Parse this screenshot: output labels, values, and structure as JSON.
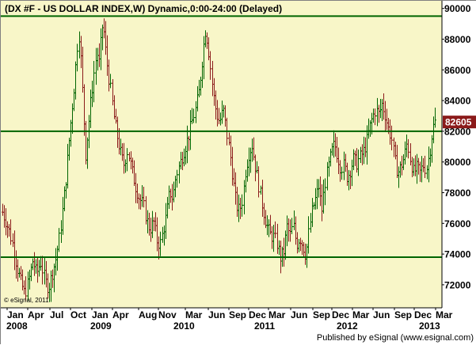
{
  "chart_data": {
    "type": "bar",
    "subtype": "ohlc-weekly",
    "title": "(DX #F - US DOLLAR INDEX,W) Dynamic,0:00-24:00 (Delayed)",
    "ylim": [
      70500,
      90500
    ],
    "yticks": [
      72000,
      74000,
      76000,
      78000,
      80000,
      82000,
      84000,
      86000,
      88000,
      90000
    ],
    "ytick_labels": [
      "72000",
      "74000",
      "76000",
      "78000",
      "80000",
      "82000",
      "84000",
      "86000",
      "88000",
      "90000"
    ],
    "month_labels": [
      "Jan",
      "Apr",
      "Jul",
      "Oct",
      "Jan",
      "Apr",
      "Aug",
      "Nov",
      "Mar",
      "Jun",
      "Sep",
      "Dec",
      "Mar",
      "Jun",
      "Sep",
      "Dec",
      "Mar",
      "Jun",
      "Sep",
      "Dec",
      "Mar"
    ],
    "year_labels": [
      "2008",
      "2009",
      "2010",
      "2011",
      "2012",
      "2013"
    ],
    "last_price_label": "82605",
    "last_price": 82605,
    "horizontal_lines": [
      89500,
      82000,
      73800
    ],
    "series": [
      {
        "close_path": [
          [
            0,
            77000
          ],
          [
            6,
            76200
          ],
          [
            11,
            75400
          ],
          [
            16,
            74400
          ],
          [
            20,
            73200
          ],
          [
            25,
            72200
          ],
          [
            30,
            71400
          ],
          [
            35,
            72300
          ],
          [
            40,
            73600
          ],
          [
            45,
            72700
          ],
          [
            50,
            73500
          ],
          [
            56,
            72200
          ],
          [
            60,
            71800
          ],
          [
            64,
            72600
          ],
          [
            69,
            73600
          ],
          [
            74,
            75200
          ],
          [
            78,
            77000
          ],
          [
            82,
            79000
          ],
          [
            86,
            81400
          ],
          [
            90,
            83600
          ],
          [
            93,
            85200
          ],
          [
            96,
            87400
          ],
          [
            99,
            88400
          ],
          [
            101,
            86400
          ],
          [
            104,
            83500
          ],
          [
            107,
            80500
          ],
          [
            111,
            82600
          ],
          [
            114,
            84200
          ],
          [
            117,
            85600
          ],
          [
            121,
            87200
          ],
          [
            124,
            86400
          ],
          [
            127,
            88400
          ],
          [
            129,
            89200
          ],
          [
            131,
            87800
          ],
          [
            135,
            86000
          ],
          [
            139,
            84500
          ],
          [
            143,
            82800
          ],
          [
            147,
            81600
          ],
          [
            151,
            80600
          ],
          [
            155,
            79800
          ],
          [
            160,
            80800
          ],
          [
            165,
            79500
          ],
          [
            170,
            78400
          ],
          [
            175,
            77600
          ],
          [
            180,
            77200
          ],
          [
            184,
            76200
          ],
          [
            188,
            75600
          ],
          [
            193,
            76100
          ],
          [
            197,
            74900
          ],
          [
            201,
            74600
          ],
          [
            205,
            75600
          ],
          [
            209,
            76600
          ],
          [
            213,
            78100
          ],
          [
            217,
            77600
          ],
          [
            221,
            79100
          ],
          [
            226,
            79900
          ],
          [
            230,
            80600
          ],
          [
            234,
            81200
          ],
          [
            238,
            81900
          ],
          [
            242,
            82800
          ],
          [
            246,
            83500
          ],
          [
            250,
            84600
          ],
          [
            254,
            86600
          ],
          [
            258,
            88600
          ],
          [
            261,
            87900
          ],
          [
            264,
            86400
          ],
          [
            268,
            84400
          ],
          [
            272,
            83100
          ],
          [
            276,
            82600
          ],
          [
            281,
            83400
          ],
          [
            285,
            81900
          ],
          [
            289,
            80600
          ],
          [
            293,
            78800
          ],
          [
            297,
            77200
          ],
          [
            301,
            76800
          ],
          [
            305,
            77600
          ],
          [
            309,
            79600
          ],
          [
            313,
            80600
          ],
          [
            317,
            81100
          ],
          [
            321,
            79800
          ],
          [
            325,
            78600
          ],
          [
            329,
            77400
          ],
          [
            333,
            76400
          ],
          [
            337,
            75600
          ],
          [
            341,
            75200
          ],
          [
            345,
            75100
          ],
          [
            349,
            74600
          ],
          [
            353,
            73700
          ],
          [
            357,
            74200
          ],
          [
            361,
            75800
          ],
          [
            365,
            75200
          ],
          [
            369,
            75900
          ],
          [
            373,
            74600
          ],
          [
            377,
            75100
          ],
          [
            381,
            74600
          ],
          [
            385,
            73900
          ],
          [
            389,
            75600
          ],
          [
            393,
            76900
          ],
          [
            397,
            77600
          ],
          [
            401,
            78400
          ],
          [
            405,
            76800
          ],
          [
            409,
            78600
          ],
          [
            413,
            79600
          ],
          [
            417,
            80600
          ],
          [
            421,
            81200
          ],
          [
            425,
            80400
          ],
          [
            429,
            79600
          ],
          [
            433,
            79800
          ],
          [
            437,
            79000
          ],
          [
            441,
            79500
          ],
          [
            445,
            80200
          ],
          [
            449,
            79900
          ],
          [
            453,
            80300
          ],
          [
            457,
            80600
          ],
          [
            461,
            81200
          ],
          [
            465,
            82100
          ],
          [
            469,
            82900
          ],
          [
            473,
            83400
          ],
          [
            477,
            83100
          ],
          [
            481,
            83800
          ],
          [
            485,
            83100
          ],
          [
            489,
            82200
          ],
          [
            493,
            81600
          ],
          [
            497,
            80100
          ],
          [
            501,
            79300
          ],
          [
            505,
            79700
          ],
          [
            509,
            80300
          ],
          [
            513,
            81300
          ],
          [
            517,
            80100
          ],
          [
            521,
            79300
          ],
          [
            525,
            79600
          ],
          [
            529,
            79300
          ],
          [
            533,
            79800
          ],
          [
            537,
            79500
          ],
          [
            541,
            80600
          ],
          [
            544,
            81800
          ],
          [
            547,
            82600
          ],
          [
            549,
            82605
          ]
        ]
      }
    ],
    "grid": false
  },
  "colors": {
    "plot_bg": "#f8f6c8",
    "axis_bg": "#ffffff",
    "up_bar": "#006400",
    "down_bar": "#8b1a1a",
    "hline": "#006400",
    "last_price_bg": "#8b1a1a",
    "last_price_fg": "#ffffff"
  },
  "watermark": "© eSignal, 2011",
  "footer": "Published by eSignal (www.esignal.com)"
}
